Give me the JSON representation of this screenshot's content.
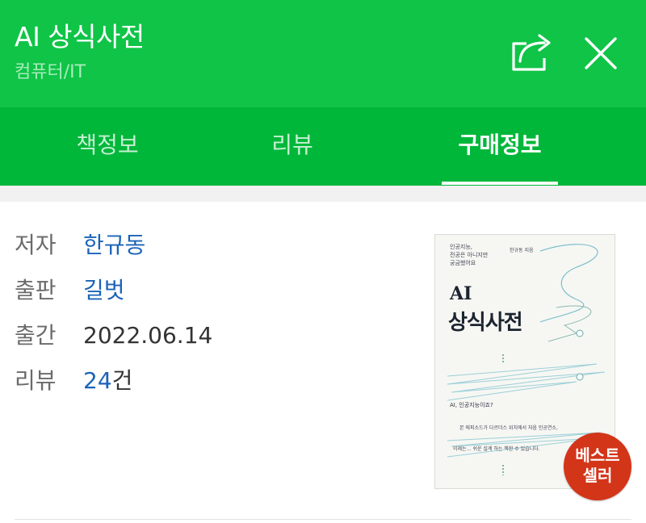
{
  "header": {
    "title": "AI 상식사전",
    "subtitle": "컴퓨터/IT"
  },
  "tabs": [
    {
      "label": "책정보",
      "active": false
    },
    {
      "label": "리뷰",
      "active": false
    },
    {
      "label": "구매정보",
      "active": true
    }
  ],
  "info": [
    {
      "key": "저자",
      "value": "한규동",
      "link": true
    },
    {
      "key": "출판",
      "value": "길벗",
      "link": true
    },
    {
      "key": "출간",
      "value": "2022.06.14",
      "link": false
    },
    {
      "key": "리뷰",
      "count": "24",
      "suffix": "건",
      "link": true
    }
  ],
  "cover": {
    "tagline1": "인공지능,",
    "tagline2": "전공은 아니지만",
    "tagline3": "궁금했어요",
    "author": "한규동 지음",
    "title_line1": "AI",
    "title_line2": "상식사전",
    "question": "AI, 인공지능이죠?",
    "desc1": "본 에피소드가 다르더스 위치에서 처음 인공연소,",
    "desc2": "이제는… 쉬운 설계 하는 책한 수 있습니다."
  },
  "badge": {
    "line1": "베스트",
    "line2": "셀러"
  },
  "colors": {
    "header_bg": "#0fc447",
    "tabs_bg": "#01b73a",
    "link": "#1b63b8",
    "badge_bg": "#d33519"
  },
  "icons": {
    "share": "share-icon",
    "close": "close-icon"
  }
}
